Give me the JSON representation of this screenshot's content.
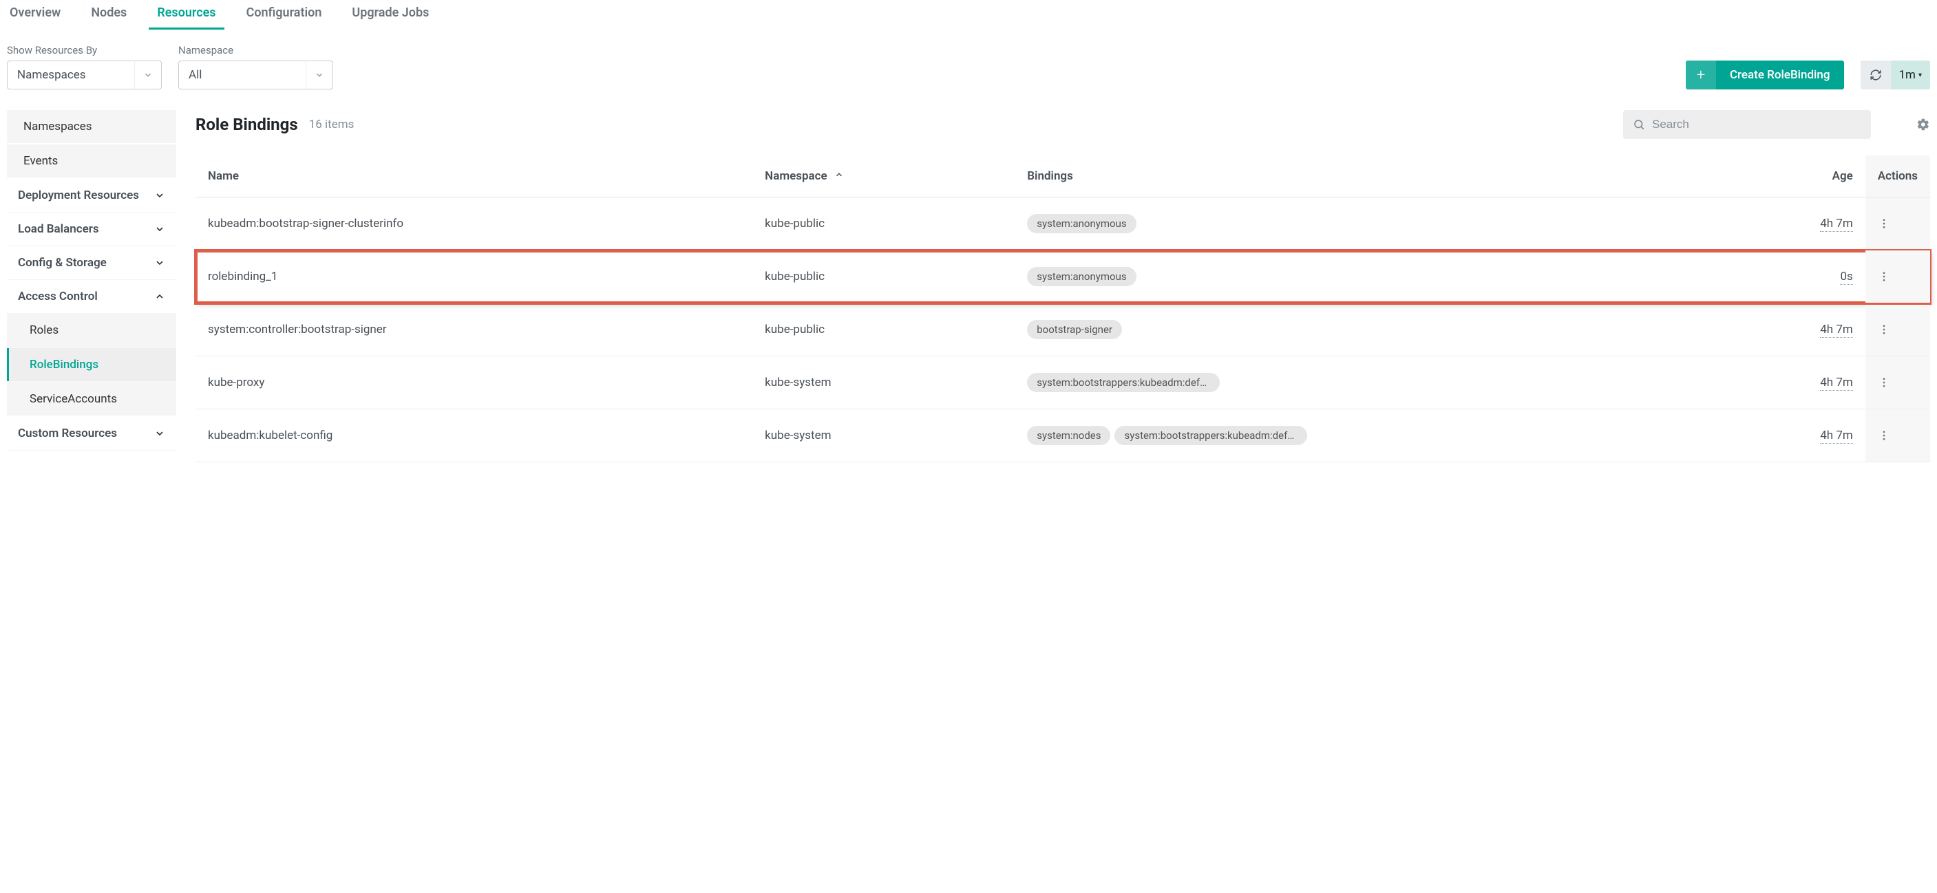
{
  "tabs": {
    "overview": "Overview",
    "nodes": "Nodes",
    "resources": "Resources",
    "configuration": "Configuration",
    "upgrade_jobs": "Upgrade Jobs"
  },
  "filters": {
    "show_by_label": "Show Resources By",
    "show_by_value": "Namespaces",
    "namespace_label": "Namespace",
    "namespace_value": "All"
  },
  "actions": {
    "create_label": "Create RoleBinding",
    "refresh_interval": "1m"
  },
  "sidebar": {
    "top_items": [
      "Namespaces",
      "Events"
    ],
    "groups": [
      {
        "label": "Deployment Resources",
        "expanded": false
      },
      {
        "label": "Load Balancers",
        "expanded": false
      },
      {
        "label": "Config & Storage",
        "expanded": false
      },
      {
        "label": "Access Control",
        "expanded": true,
        "items": [
          "Roles",
          "RoleBindings",
          "ServiceAccounts"
        ],
        "active_item": "RoleBindings"
      },
      {
        "label": "Custom Resources",
        "expanded": false
      }
    ]
  },
  "page": {
    "title": "Role Bindings",
    "count_label": "16 items",
    "search_placeholder": "Search"
  },
  "table": {
    "columns": {
      "name": "Name",
      "namespace": "Namespace",
      "bindings": "Bindings",
      "age": "Age",
      "actions": "Actions"
    },
    "rows": [
      {
        "name": "kubeadm:bootstrap-signer-clusterinfo",
        "namespace": "kube-public",
        "bindings": [
          "system:anonymous"
        ],
        "age": "4h 7m",
        "highlight": false
      },
      {
        "name": "rolebinding_1",
        "namespace": "kube-public",
        "bindings": [
          "system:anonymous"
        ],
        "age": "0s",
        "highlight": true
      },
      {
        "name": "system:controller:bootstrap-signer",
        "namespace": "kube-public",
        "bindings": [
          "bootstrap-signer"
        ],
        "age": "4h 7m",
        "highlight": false
      },
      {
        "name": "kube-proxy",
        "namespace": "kube-system",
        "bindings": [
          "system:bootstrappers:kubeadm:defau…"
        ],
        "age": "4h 7m",
        "highlight": false
      },
      {
        "name": "kubeadm:kubelet-config",
        "namespace": "kube-system",
        "bindings": [
          "system:nodes",
          "system:bootstrappers:kubeadm:defau…"
        ],
        "age": "4h 7m",
        "highlight": false
      }
    ]
  }
}
